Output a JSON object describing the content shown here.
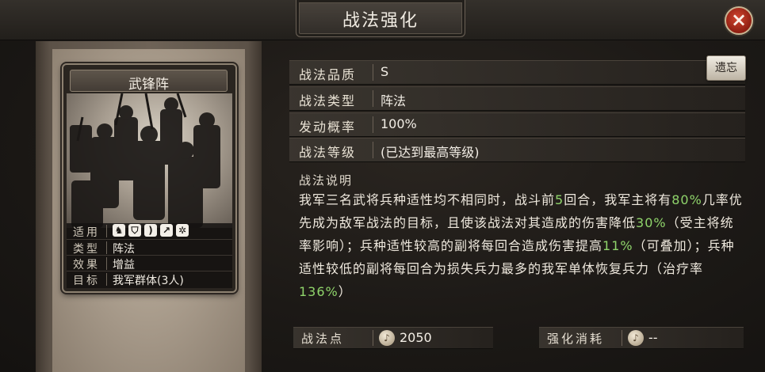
{
  "header": {
    "title": "战法强化",
    "close_icon": "close-icon"
  },
  "card": {
    "name": "武锋阵",
    "info": [
      {
        "label": "适用",
        "icons": [
          "cavalry-icon",
          "shield-icon",
          "bow-icon",
          "spear-icon",
          "wheel-icon"
        ]
      },
      {
        "label": "类型",
        "value": "阵法"
      },
      {
        "label": "效果",
        "value": "增益"
      },
      {
        "label": "目标",
        "value": "我军群体(3人)"
      }
    ]
  },
  "attributes": [
    {
      "label": "战法品质",
      "value": "S"
    },
    {
      "label": "战法类型",
      "value": "阵法"
    },
    {
      "label": "发动概率",
      "value": "100%"
    },
    {
      "label": "战法等级",
      "value": "(已达到最高等级)"
    }
  ],
  "legacy_button": "遗忘",
  "description": {
    "title": "战法说明",
    "segments": [
      {
        "text": "我军三名武将兵种适性均不相同时，战斗前",
        "hl": false
      },
      {
        "text": "5",
        "hl": true
      },
      {
        "text": "回合，我军主将有",
        "hl": false
      },
      {
        "text": "80%",
        "hl": true
      },
      {
        "text": "几率优先成为敌军战法的目标，且使该战法对其造成的伤害降低",
        "hl": false
      },
      {
        "text": "30%",
        "hl": true
      },
      {
        "text": "（受主将统率影响）；兵种适性较高的副将每回合造成伤害提高",
        "hl": false
      },
      {
        "text": "11%",
        "hl": true
      },
      {
        "text": "（可叠加）；兵种适性较低的副将每回合为损失兵力最多的我军单体恢复兵力（治疗率",
        "hl": false
      },
      {
        "text": "136%",
        "hl": true
      },
      {
        "text": "）",
        "hl": false
      }
    ]
  },
  "footer": {
    "points_label": "战法点",
    "points_value": "2050",
    "cost_label": "强化消耗",
    "cost_value": "--",
    "coin_icon": "tactic-point-icon"
  },
  "colors": {
    "highlight": "#8fd46b",
    "close_red": "#c0392b"
  }
}
